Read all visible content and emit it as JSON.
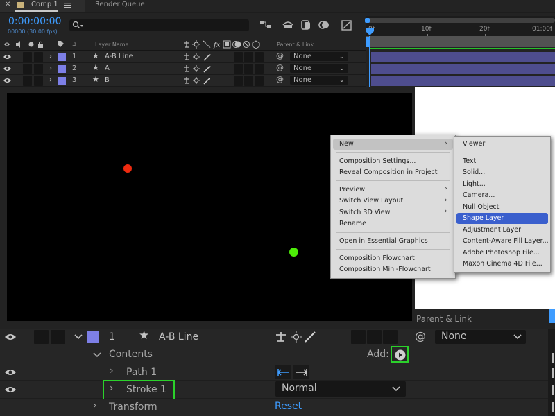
{
  "tabs": {
    "comp_tab_label": "Comp 1",
    "render_queue_label": "Render Queue"
  },
  "timeline": {
    "timecode": "0:00:00:00",
    "fps_readout": "00000 (30.00 fps)",
    "search_placeholder": "",
    "ruler_labels": [
      "0f",
      "10f",
      "20f",
      "01:00f"
    ],
    "column_headers": {
      "number": "#",
      "layer_name": "Layer Name",
      "parent_link": "Parent & Link"
    },
    "layers": [
      {
        "number": "1",
        "name": "A-B Line",
        "parent": "None"
      },
      {
        "number": "2",
        "name": "A",
        "parent": "None"
      },
      {
        "number": "3",
        "name": "B",
        "parent": "None"
      }
    ]
  },
  "viewer": {
    "parent_link_label": "Parent & Link"
  },
  "context_menu": {
    "items": [
      {
        "label": "New",
        "has_submenu": true,
        "state": "hover"
      },
      {
        "label": "Composition Settings..."
      },
      {
        "label": "Reveal Composition in Project"
      },
      {
        "label": "Preview",
        "has_submenu": true
      },
      {
        "label": "Switch View Layout",
        "has_submenu": true
      },
      {
        "label": "Switch 3D View",
        "has_submenu": true
      },
      {
        "label": "Rename"
      },
      {
        "label": "Open in Essential Graphics"
      },
      {
        "label": "Composition Flowchart"
      },
      {
        "label": "Composition Mini-Flowchart"
      }
    ]
  },
  "submenu_new": {
    "items": [
      {
        "label": "Viewer"
      },
      {
        "label": "Text"
      },
      {
        "label": "Solid..."
      },
      {
        "label": "Light..."
      },
      {
        "label": "Camera..."
      },
      {
        "label": "Null Object"
      },
      {
        "label": "Shape Layer",
        "state": "selected"
      },
      {
        "label": "Adjustment Layer"
      },
      {
        "label": "Content-Aware Fill Layer..."
      },
      {
        "label": "Adobe Photoshop File..."
      },
      {
        "label": "Maxon Cinema 4D File..."
      }
    ]
  },
  "properties": {
    "layer_number": "1",
    "layer_name": "A-B Line",
    "parent": "None",
    "contents_label": "Contents",
    "add_label": "Add:",
    "path_label": "Path 1",
    "stroke_label": "Stroke 1",
    "blend_mode": "Normal",
    "transform_label": "Transform",
    "reset_label": "Reset"
  },
  "colors": {
    "accent_blue": "#3e9cff",
    "label_purple": "#7d7fe6",
    "track_purple": "#4e4d8e",
    "highlight_green": "#2bd12b",
    "menu_selected": "#3a5fcd",
    "dot_red": "#ee2a0f",
    "dot_green": "#4ded08"
  }
}
